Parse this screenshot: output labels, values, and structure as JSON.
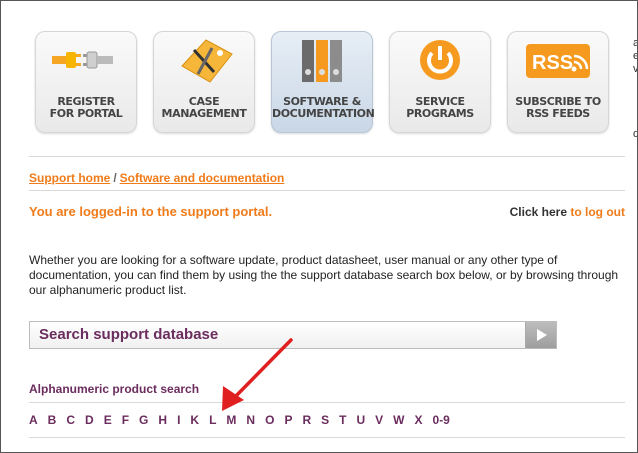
{
  "tiles": [
    {
      "line1": "REGISTER",
      "line2": "FOR PORTAL",
      "icon": "plug-icon"
    },
    {
      "line1": "CASE",
      "line2": "MANAGEMENT",
      "icon": "tag-tools-icon"
    },
    {
      "line1": "SOFTWARE &",
      "line2": "DOCUMENTATION",
      "icon": "binders-icon"
    },
    {
      "line1": "SERVICE",
      "line2": "PROGRAMS",
      "icon": "power-icon"
    },
    {
      "line1": "SUBSCRIBE TO",
      "line2": "RSS FEEDS",
      "icon": "rss-icon",
      "badge": "RSS"
    }
  ],
  "breadcrumb": {
    "home": "Support home",
    "sep": "/",
    "current": "Software and documentation"
  },
  "status": {
    "logged_in": "You are logged-in to the support portal.",
    "logout_prefix": "Click here",
    "logout_link": "to log out"
  },
  "intro": "Whether you are looking for a software update, product datasheet, user manual or any other type of documentation, you can find them by using the the support database search box below, or by browsing through our alphanumeric product list.",
  "search": {
    "label": "Search support database"
  },
  "alpha": {
    "title": "Alphanumeric product search",
    "letters": [
      "A",
      "B",
      "C",
      "D",
      "E",
      "F",
      "G",
      "H",
      "I",
      "K",
      "L",
      "M",
      "N",
      "O",
      "P",
      "R",
      "S",
      "T",
      "U",
      "V",
      "W",
      "X",
      "0-9"
    ]
  },
  "colors": {
    "accent": "#f07b1a",
    "brand": "#6b2c5e",
    "annotation_arrow": "#e02020"
  }
}
